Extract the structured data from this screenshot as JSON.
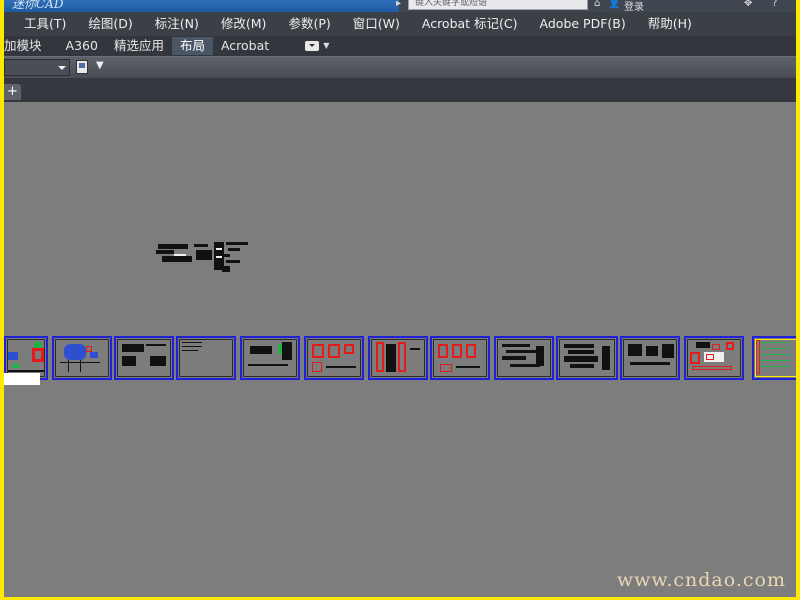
{
  "titlebar": {
    "search_placeholder": "键入关键字或短语",
    "login_label": "登录",
    "logo_text": "迷你CAD"
  },
  "menubar": {
    "items": [
      "工具(T)",
      "绘图(D)",
      "标注(N)",
      "修改(M)",
      "参数(P)",
      "窗口(W)",
      "Acrobat 标记(C)",
      "Adobe PDF(B)",
      "帮助(H)"
    ]
  },
  "ribbon": {
    "tabs": [
      "加模块",
      "A360",
      "精选应用",
      "布局",
      "Acrobat"
    ],
    "active_tab": "布局"
  },
  "tabstrip": {
    "add_label": "+"
  },
  "watermark": "www.cndao.com",
  "colors": {
    "background": "#7d7d7d",
    "menubar": "#3b3f46",
    "selection_border": "#2020d8",
    "accent_red": "#e31b1b",
    "frame_yellow": "#ffe800"
  },
  "icons": [
    "home-icon",
    "user-icon",
    "toolbar-layer-icon",
    "dropdown-icon",
    "add-tab-icon",
    "message-icon"
  ]
}
